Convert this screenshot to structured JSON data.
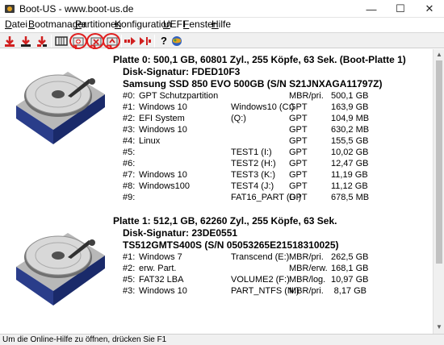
{
  "window": {
    "title": "Boot-US - www.boot-us.de",
    "minimize": "—",
    "maximize": "☐",
    "close": "✕"
  },
  "menu": [
    {
      "label": "Datei",
      "ul": "D",
      "rest": "atei"
    },
    {
      "label": "Bootmanager",
      "ul": "B",
      "rest": "ootmanager"
    },
    {
      "label": "Partitionen",
      "ul": "P",
      "rest": "artitionen"
    },
    {
      "label": "Konfiguration",
      "ul": "K",
      "rest": "onfiguration"
    },
    {
      "label": "UEFI",
      "ul": "U",
      "rest": "EFI"
    },
    {
      "label": "Fenster",
      "ul": "F",
      "rest": "enster"
    },
    {
      "label": "Hilfe",
      "ul": "H",
      "rest": "ilfe"
    }
  ],
  "toolbar": {
    "callouts": [
      "1",
      "2",
      "3"
    ],
    "help_glyph": "?"
  },
  "disks": [
    {
      "heading": "Platte 0:  500,1 GB,  60801 Zyl., 255 Köpfe, 63 Sek. (Boot-Platte 1)",
      "signature": "Disk-Signatur:  FDED10F3",
      "model": "Samsung SSD 850 EVO 500GB  (S/N S21JNXAGA11797Z)",
      "partitions": [
        {
          "num": "#0:",
          "name": "GPT Schutzpartition",
          "label": "",
          "type": "MBR/pri.",
          "size": "500,1 GB"
        },
        {
          "num": "#1:",
          "name": "Windows 10",
          "label": "Windows10 (C:)",
          "type": "GPT",
          "size": "163,9 GB"
        },
        {
          "num": "#2:",
          "name": "EFI System",
          "label": "(Q:)",
          "type": "GPT",
          "size": "104,9 MB"
        },
        {
          "num": "#3:",
          "name": "Windows 10",
          "label": "",
          "type": "GPT",
          "size": "630,2 MB"
        },
        {
          "num": "#4:",
          "name": "Linux",
          "label": "",
          "type": "GPT",
          "size": "155,5 GB"
        },
        {
          "num": "#5:",
          "name": "",
          "label": "TEST1 (I:)",
          "type": "GPT",
          "size": "10,02 GB"
        },
        {
          "num": "#6:",
          "name": "",
          "label": "TEST2 (H:)",
          "type": "GPT",
          "size": "12,47 GB"
        },
        {
          "num": "#7:",
          "name": "Windows 10",
          "label": "TEST3 (K:)",
          "type": "GPT",
          "size": "11,19 GB"
        },
        {
          "num": "#8:",
          "name": "Windows100",
          "label": "TEST4 (J:)",
          "type": "GPT",
          "size": "11,12 GB"
        },
        {
          "num": "#9:",
          "name": "",
          "label": "FAT16_PART (D:)",
          "type": "GPT",
          "size": "678,5 MB"
        }
      ]
    },
    {
      "heading": "Platte 1:  512,1 GB,  62260 Zyl., 255 Köpfe, 63 Sek.",
      "signature": "Disk-Signatur:  23DE0551",
      "model": "TS512GMTS400S  (S/N 05053265E21518310025)",
      "partitions": [
        {
          "num": "#1:",
          "name": "Windows 7",
          "label": "Transcend (E:)",
          "type": "MBR/pri.",
          "size": "262,5 GB"
        },
        {
          "num": "#2:",
          "name": "erw. Part.",
          "label": "",
          "type": "MBR/erw.",
          "size": "168,1 GB"
        },
        {
          "num": "#5:",
          "name": "FAT32 LBA",
          "label": "VOLUME2 (F:)",
          "type": "MBR/log.",
          "size": "10,97 GB"
        },
        {
          "num": "#3:",
          "name": "Windows 10",
          "label": "PART_NTFS (N:)",
          "type": "MBR/pri.",
          "size": "8,17 GB"
        }
      ]
    }
  ],
  "status": "Um die Online-Hilfe zu öffnen, drücken Sie F1",
  "colors": {
    "accent_red": "#e02020",
    "disk_blue": "#2a3d8a"
  }
}
